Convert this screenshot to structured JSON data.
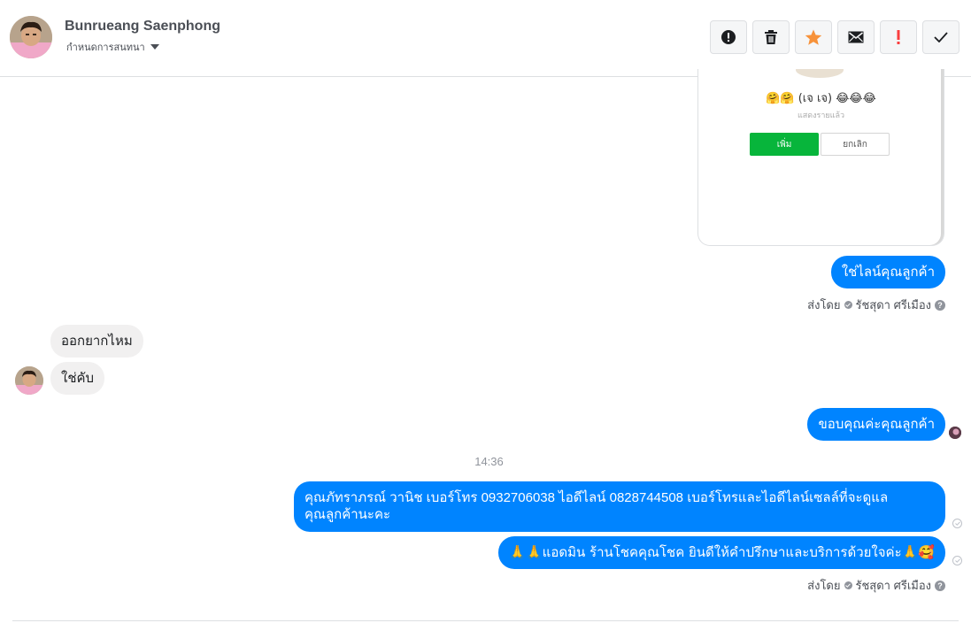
{
  "header": {
    "contact_name": "Bunrueang Saenphong",
    "subtitle": "กำหนดการสนทนา",
    "actions": [
      {
        "name": "spam-button",
        "icon": "alert-circle-icon"
      },
      {
        "name": "delete-button",
        "icon": "trash-icon"
      },
      {
        "name": "star-button",
        "icon": "star-icon"
      },
      {
        "name": "mark-unread-button",
        "icon": "envelope-icon"
      },
      {
        "name": "important-button",
        "icon": "exclamation-icon"
      },
      {
        "name": "done-button",
        "icon": "checkmark-icon"
      }
    ]
  },
  "image_card": {
    "name": "🤗🤗 (เจ เจ) 😂😂😂",
    "status": "แสดงรายแล้ว",
    "add_label": "เพิ่ม",
    "cancel_label": "ยกเลิก"
  },
  "messages": {
    "out_1": "ใช่ไลน์คุณลูกค้า",
    "sent_by_1": "ส่งโดย",
    "sender_1": "รัชสุดา ศรีเมือง",
    "in_1": "ออกยากไหม",
    "in_2": "ใช่คับ",
    "out_2": "ขอบคุณค่ะคุณลูกค้า",
    "time": "14:36",
    "out_3_line1": "คุณภัทราภรณ์  วานิช      เบอร์โทร 0932706038  ไอดีไลน์ 0828744508  เบอร์โทรและไอดีไลน์เซลล์ที่จะดูแล",
    "out_3_line2": "คุณลูกค้านะคะ",
    "out_4": "🙏🙏แอดมิน ร้านโชคคุณโชค ยินดีให้คำปรึกษาและบริการด้วยใจค่ะ🙏🥰",
    "sent_by_2": "ส่งโดย",
    "sender_2": "รัชสุดา ศรีเมือง"
  },
  "colors": {
    "outgoing": "#0084ff",
    "incoming": "#f1f0f0",
    "line_green": "#07b53b",
    "star": "#f7923a",
    "alert_red": "#fa3e3e"
  }
}
